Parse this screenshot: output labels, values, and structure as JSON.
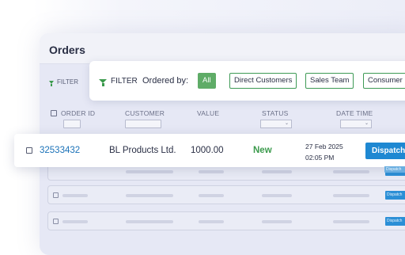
{
  "page": {
    "title": "Orders"
  },
  "background_filter": {
    "label": "FILTER"
  },
  "filter_card": {
    "filter_label": "FILTER",
    "ordered_by_label": "Ordered by:",
    "chips": [
      "All",
      "Direct Customers",
      "Sales Team",
      "Consumer"
    ],
    "active_chip": "All"
  },
  "table": {
    "columns": [
      "ORDER ID",
      "CUSTOMER",
      "VALUE",
      "STATUS",
      "DATE TIME"
    ],
    "highlight_row": {
      "order_id": "32533432",
      "customer": "BL Products Ltd.",
      "value": "1000.00",
      "status": "New",
      "date": "27 Feb 2025",
      "time": "02:05 PM",
      "action": "Dispatch"
    },
    "ghost_action": "Dispatch"
  },
  "colors": {
    "accent_green": "#3b9a4c",
    "action_blue": "#1e88d2",
    "link_blue": "#1b72b8"
  }
}
